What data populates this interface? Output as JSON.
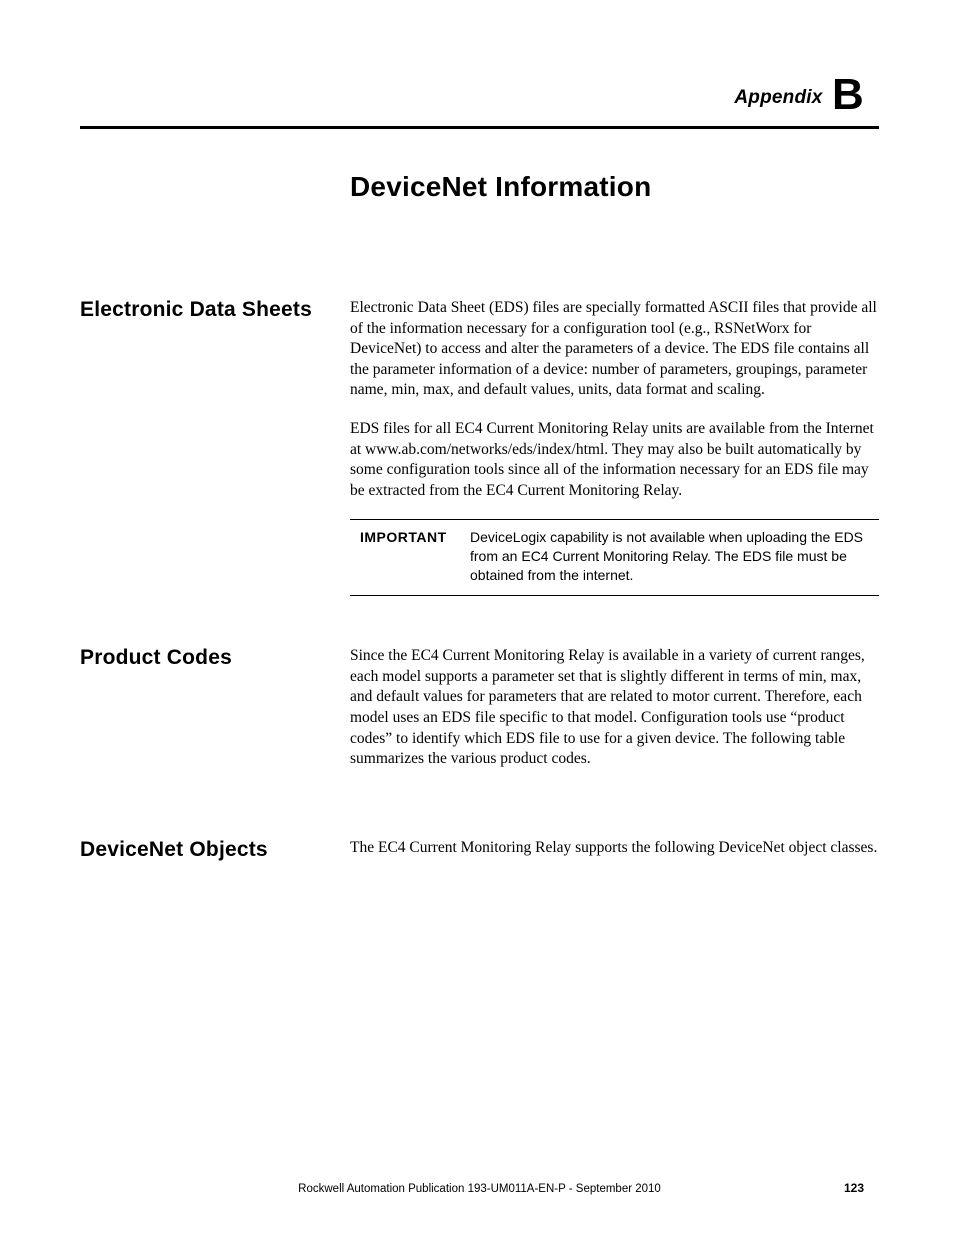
{
  "header": {
    "appendix_word": "Appendix",
    "appendix_letter": "B"
  },
  "chapter_title": "DeviceNet Information",
  "sections": {
    "eds": {
      "heading": "Electronic Data Sheets",
      "p1": "Electronic Data Sheet (EDS) files are specially formatted ASCII files that provide all of the information necessary for a configuration tool (e.g., RSNetWorx for DeviceNet) to access and alter the parameters of a device. The EDS file contains all the parameter information of a device: number of parameters, groupings, parameter name, min, max, and default values, units, data format and scaling.",
      "p2": "EDS files for all EC4 Current Monitoring Relay units are available from the Internet at www.ab.com/networks/eds/index/html. They may also be built automatically by some configuration tools since all of the information necessary for an EDS file may be extracted from the EC4 Current Monitoring Relay.",
      "important_label": "IMPORTANT",
      "important_text": "DeviceLogix capability is not available when uploading the EDS from an EC4 Current Monitoring Relay.  The EDS file must be obtained from the internet."
    },
    "product_codes": {
      "heading": "Product Codes",
      "p1": "Since the EC4 Current Monitoring Relay is available in a variety of current ranges, each model supports a parameter set that is slightly different in terms of min, max, and default values for parameters that are related to motor current. Therefore, each model uses an EDS file specific to that model. Configuration tools use “product codes” to identify which EDS file to use for a given device. The following table summarizes the various product codes."
    },
    "devicenet_objects": {
      "heading": "DeviceNet Objects",
      "p1": "The EC4 Current Monitoring Relay supports the following DeviceNet object classes."
    }
  },
  "footer": {
    "publication": "Rockwell Automation Publication 193-UM011A-EN-P - September 2010",
    "page_number": "123"
  }
}
